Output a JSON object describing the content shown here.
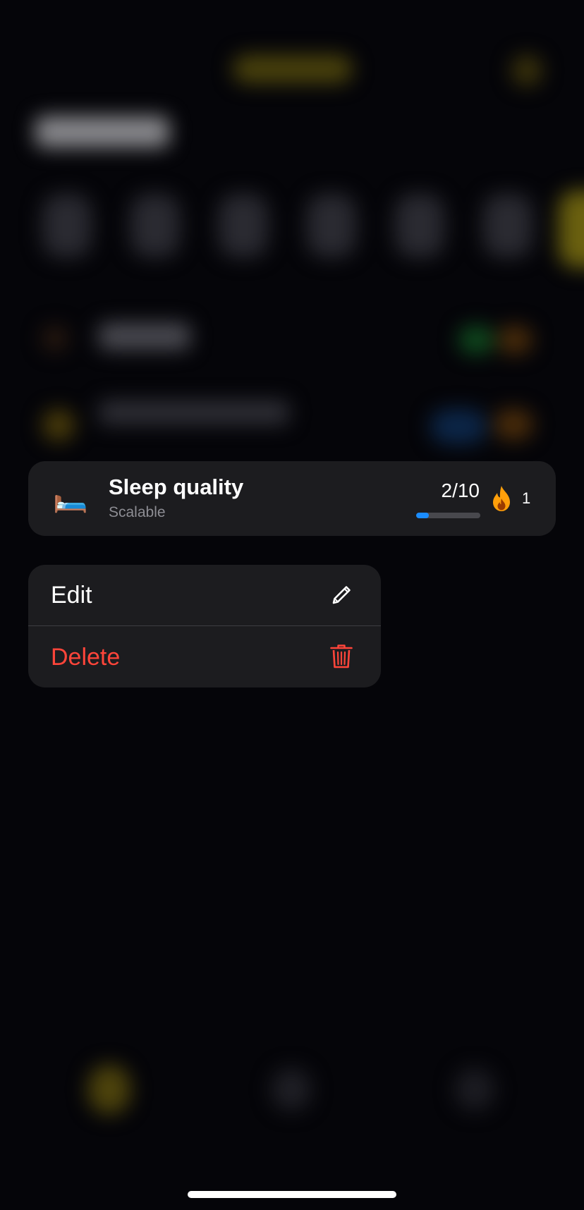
{
  "habit_card": {
    "emoji": "🛏️",
    "title": "Sleep quality",
    "subtitle": "Scalable",
    "progress_text": "2/10",
    "progress_fraction": 0.2,
    "streak_icon": "flame-icon",
    "streak_count": "1"
  },
  "context_menu": {
    "edit_label": "Edit",
    "edit_icon": "pencil-icon",
    "delete_label": "Delete",
    "delete_icon": "trash-icon"
  },
  "colors": {
    "background": "#050509",
    "card": "#1c1c1f",
    "text_primary": "#ffffff",
    "text_secondary": "#8d8d93",
    "progress_accent": "#1a8cff",
    "streak_flame": "#ff9f0a",
    "destructive": "#ff453a"
  }
}
